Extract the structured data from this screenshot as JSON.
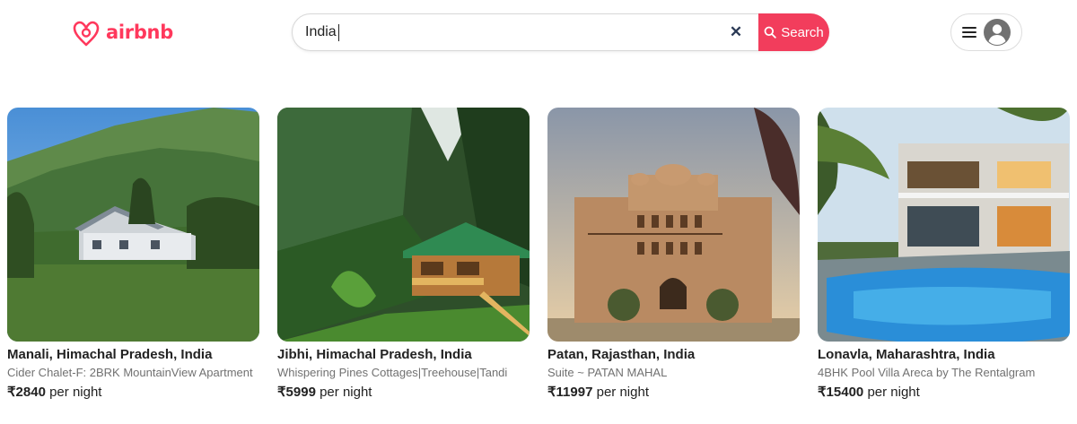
{
  "brand": {
    "name": "airbnb",
    "color": "#ff385c"
  },
  "search": {
    "value": "India",
    "clear_icon": "close-icon",
    "button_label": "Search",
    "button_color": "#f23d5c"
  },
  "user_menu": {
    "menu_icon": "hamburger-icon",
    "avatar_icon": "user-avatar-icon"
  },
  "listings": [
    {
      "location": "Manali, Himachal Pradesh, India",
      "name": "Cider Chalet-F: 2BRK MountainView Apartment",
      "price": "₹2840",
      "unit": "per night"
    },
    {
      "location": "Jibhi, Himachal Pradesh, India",
      "name": "Whispering Pines Cottages|Treehouse|Tandi",
      "price": "₹5999",
      "unit": "per night"
    },
    {
      "location": "Patan, Rajasthan, India",
      "name": "Suite ~ PATAN MAHAL",
      "price": "₹11997",
      "unit": "per night"
    },
    {
      "location": "Lonavla, Maharashtra, India",
      "name": "4BHK Pool Villa Areca by The Rentalgram",
      "price": "₹15400",
      "unit": "per night"
    }
  ]
}
